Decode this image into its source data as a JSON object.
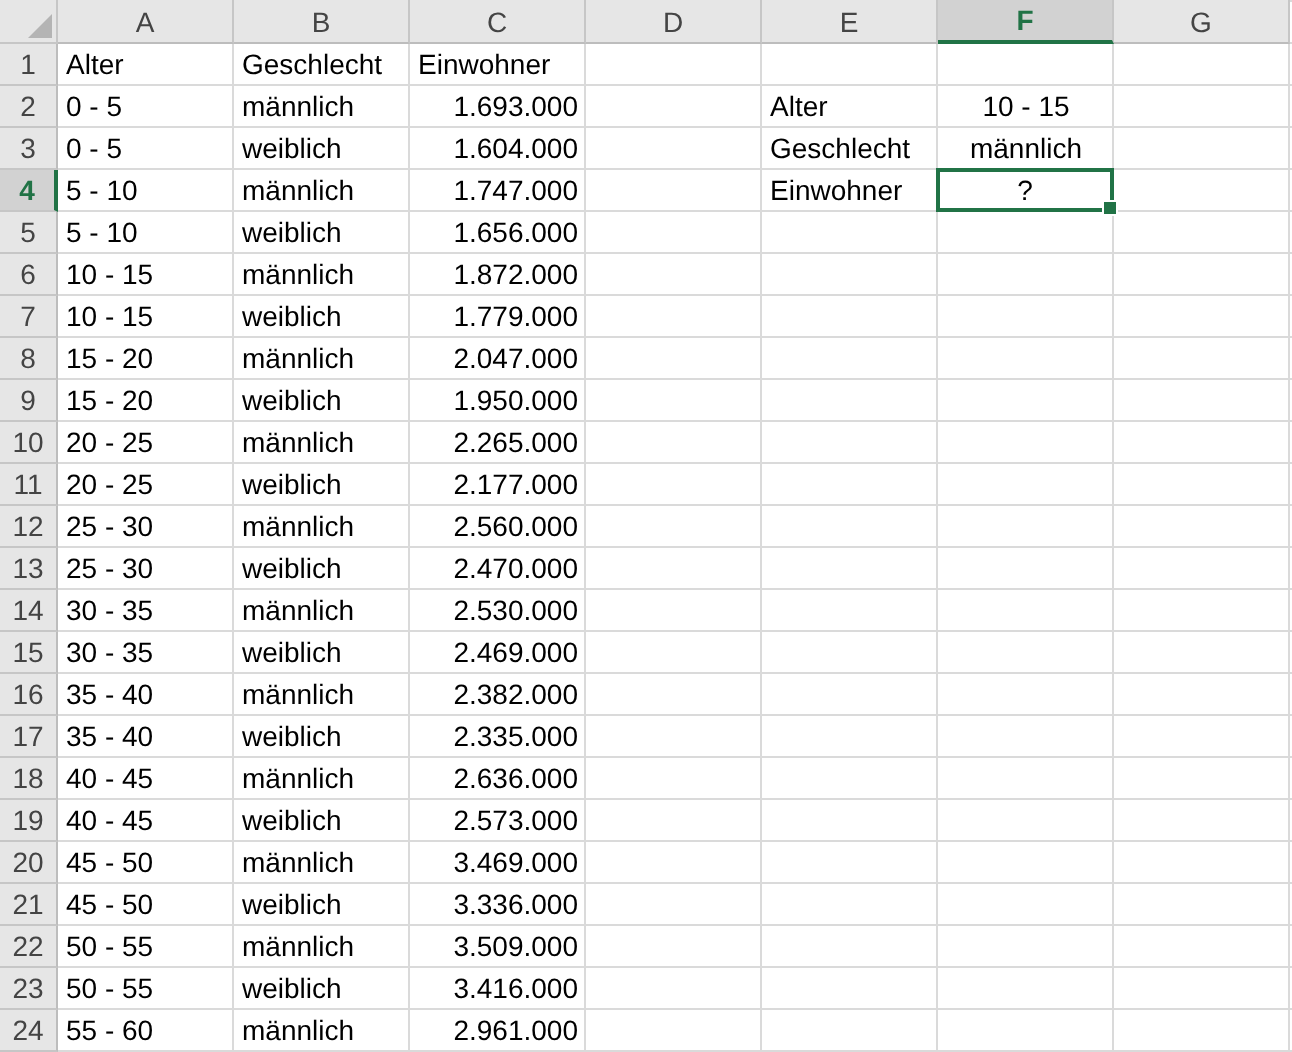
{
  "columns": [
    {
      "label": "A",
      "selected": false
    },
    {
      "label": "B",
      "selected": false
    },
    {
      "label": "C",
      "selected": false
    },
    {
      "label": "D",
      "selected": false
    },
    {
      "label": "E",
      "selected": false
    },
    {
      "label": "F",
      "selected": true
    },
    {
      "label": "G",
      "selected": false
    }
  ],
  "rows": [
    {
      "number": "1",
      "selected": false,
      "cells": [
        {
          "text": "Alter",
          "kind": "label",
          "selected": false
        },
        {
          "text": "Geschlecht",
          "kind": "label",
          "selected": false
        },
        {
          "text": "Einwohner",
          "kind": "label",
          "selected": false
        },
        null,
        null,
        null,
        null
      ]
    },
    {
      "number": "2",
      "selected": false,
      "cells": [
        {
          "text": "0 - 5",
          "kind": "label",
          "selected": false
        },
        {
          "text": "männlich",
          "kind": "label",
          "selected": false
        },
        {
          "text": "1.693.000",
          "kind": "number",
          "selected": false
        },
        null,
        {
          "text": "Alter",
          "kind": "label",
          "selected": false
        },
        {
          "text": "10 - 15",
          "kind": "value",
          "selected": false
        },
        null
      ]
    },
    {
      "number": "3",
      "selected": false,
      "cells": [
        {
          "text": "0 - 5",
          "kind": "label",
          "selected": false
        },
        {
          "text": "weiblich",
          "kind": "label",
          "selected": false
        },
        {
          "text": "1.604.000",
          "kind": "number",
          "selected": false
        },
        null,
        {
          "text": "Geschlecht",
          "kind": "label",
          "selected": false
        },
        {
          "text": "männlich",
          "kind": "value",
          "selected": false
        },
        null
      ]
    },
    {
      "number": "4",
      "selected": true,
      "cells": [
        {
          "text": "5 - 10",
          "kind": "label",
          "selected": false
        },
        {
          "text": "männlich",
          "kind": "label",
          "selected": false
        },
        {
          "text": "1.747.000",
          "kind": "number",
          "selected": false
        },
        null,
        {
          "text": "Einwohner",
          "kind": "label",
          "selected": false
        },
        {
          "text": "?",
          "kind": "value",
          "selected": true
        },
        null
      ]
    },
    {
      "number": "5",
      "selected": false,
      "cells": [
        {
          "text": "5 - 10",
          "kind": "label",
          "selected": false
        },
        {
          "text": "weiblich",
          "kind": "label",
          "selected": false
        },
        {
          "text": "1.656.000",
          "kind": "number",
          "selected": false
        },
        null,
        null,
        null,
        null
      ]
    },
    {
      "number": "6",
      "selected": false,
      "cells": [
        {
          "text": "10 - 15",
          "kind": "label",
          "selected": false
        },
        {
          "text": "männlich",
          "kind": "label",
          "selected": false
        },
        {
          "text": "1.872.000",
          "kind": "number",
          "selected": false
        },
        null,
        null,
        null,
        null
      ]
    },
    {
      "number": "7",
      "selected": false,
      "cells": [
        {
          "text": "10 - 15",
          "kind": "label",
          "selected": false
        },
        {
          "text": "weiblich",
          "kind": "label",
          "selected": false
        },
        {
          "text": "1.779.000",
          "kind": "number",
          "selected": false
        },
        null,
        null,
        null,
        null
      ]
    },
    {
      "number": "8",
      "selected": false,
      "cells": [
        {
          "text": "15 - 20",
          "kind": "label",
          "selected": false
        },
        {
          "text": "männlich",
          "kind": "label",
          "selected": false
        },
        {
          "text": "2.047.000",
          "kind": "number",
          "selected": false
        },
        null,
        null,
        null,
        null
      ]
    },
    {
      "number": "9",
      "selected": false,
      "cells": [
        {
          "text": "15 - 20",
          "kind": "label",
          "selected": false
        },
        {
          "text": "weiblich",
          "kind": "label",
          "selected": false
        },
        {
          "text": "1.950.000",
          "kind": "number",
          "selected": false
        },
        null,
        null,
        null,
        null
      ]
    },
    {
      "number": "10",
      "selected": false,
      "cells": [
        {
          "text": "20 - 25",
          "kind": "label",
          "selected": false
        },
        {
          "text": "männlich",
          "kind": "label",
          "selected": false
        },
        {
          "text": "2.265.000",
          "kind": "number",
          "selected": false
        },
        null,
        null,
        null,
        null
      ]
    },
    {
      "number": "11",
      "selected": false,
      "cells": [
        {
          "text": "20 - 25",
          "kind": "label",
          "selected": false
        },
        {
          "text": "weiblich",
          "kind": "label",
          "selected": false
        },
        {
          "text": "2.177.000",
          "kind": "number",
          "selected": false
        },
        null,
        null,
        null,
        null
      ]
    },
    {
      "number": "12",
      "selected": false,
      "cells": [
        {
          "text": "25 - 30",
          "kind": "label",
          "selected": false
        },
        {
          "text": "männlich",
          "kind": "label",
          "selected": false
        },
        {
          "text": "2.560.000",
          "kind": "number",
          "selected": false
        },
        null,
        null,
        null,
        null
      ]
    },
    {
      "number": "13",
      "selected": false,
      "cells": [
        {
          "text": "25 - 30",
          "kind": "label",
          "selected": false
        },
        {
          "text": "weiblich",
          "kind": "label",
          "selected": false
        },
        {
          "text": "2.470.000",
          "kind": "number",
          "selected": false
        },
        null,
        null,
        null,
        null
      ]
    },
    {
      "number": "14",
      "selected": false,
      "cells": [
        {
          "text": "30 - 35",
          "kind": "label",
          "selected": false
        },
        {
          "text": "männlich",
          "kind": "label",
          "selected": false
        },
        {
          "text": "2.530.000",
          "kind": "number",
          "selected": false
        },
        null,
        null,
        null,
        null
      ]
    },
    {
      "number": "15",
      "selected": false,
      "cells": [
        {
          "text": "30 - 35",
          "kind": "label",
          "selected": false
        },
        {
          "text": "weiblich",
          "kind": "label",
          "selected": false
        },
        {
          "text": "2.469.000",
          "kind": "number",
          "selected": false
        },
        null,
        null,
        null,
        null
      ]
    },
    {
      "number": "16",
      "selected": false,
      "cells": [
        {
          "text": "35 - 40",
          "kind": "label",
          "selected": false
        },
        {
          "text": "männlich",
          "kind": "label",
          "selected": false
        },
        {
          "text": "2.382.000",
          "kind": "number",
          "selected": false
        },
        null,
        null,
        null,
        null
      ]
    },
    {
      "number": "17",
      "selected": false,
      "cells": [
        {
          "text": "35 - 40",
          "kind": "label",
          "selected": false
        },
        {
          "text": "weiblich",
          "kind": "label",
          "selected": false
        },
        {
          "text": "2.335.000",
          "kind": "number",
          "selected": false
        },
        null,
        null,
        null,
        null
      ]
    },
    {
      "number": "18",
      "selected": false,
      "cells": [
        {
          "text": "40 - 45",
          "kind": "label",
          "selected": false
        },
        {
          "text": "männlich",
          "kind": "label",
          "selected": false
        },
        {
          "text": "2.636.000",
          "kind": "number",
          "selected": false
        },
        null,
        null,
        null,
        null
      ]
    },
    {
      "number": "19",
      "selected": false,
      "cells": [
        {
          "text": "40 - 45",
          "kind": "label",
          "selected": false
        },
        {
          "text": "weiblich",
          "kind": "label",
          "selected": false
        },
        {
          "text": "2.573.000",
          "kind": "number",
          "selected": false
        },
        null,
        null,
        null,
        null
      ]
    },
    {
      "number": "20",
      "selected": false,
      "cells": [
        {
          "text": "45 - 50",
          "kind": "label",
          "selected": false
        },
        {
          "text": "männlich",
          "kind": "label",
          "selected": false
        },
        {
          "text": "3.469.000",
          "kind": "number",
          "selected": false
        },
        null,
        null,
        null,
        null
      ]
    },
    {
      "number": "21",
      "selected": false,
      "cells": [
        {
          "text": "45 - 50",
          "kind": "label",
          "selected": false
        },
        {
          "text": "weiblich",
          "kind": "label",
          "selected": false
        },
        {
          "text": "3.336.000",
          "kind": "number",
          "selected": false
        },
        null,
        null,
        null,
        null
      ]
    },
    {
      "number": "22",
      "selected": false,
      "cells": [
        {
          "text": "50 - 55",
          "kind": "label",
          "selected": false
        },
        {
          "text": "männlich",
          "kind": "label",
          "selected": false
        },
        {
          "text": "3.509.000",
          "kind": "number",
          "selected": false
        },
        null,
        null,
        null,
        null
      ]
    },
    {
      "number": "23",
      "selected": false,
      "cells": [
        {
          "text": "50 - 55",
          "kind": "label",
          "selected": false
        },
        {
          "text": "weiblich",
          "kind": "label",
          "selected": false
        },
        {
          "text": "3.416.000",
          "kind": "number",
          "selected": false
        },
        null,
        null,
        null,
        null
      ]
    },
    {
      "number": "24",
      "selected": false,
      "cells": [
        {
          "text": "55 - 60",
          "kind": "label",
          "selected": false
        },
        {
          "text": "männlich",
          "kind": "label",
          "selected": false
        },
        {
          "text": "2.961.000",
          "kind": "number",
          "selected": false
        },
        null,
        null,
        null,
        null
      ]
    }
  ]
}
